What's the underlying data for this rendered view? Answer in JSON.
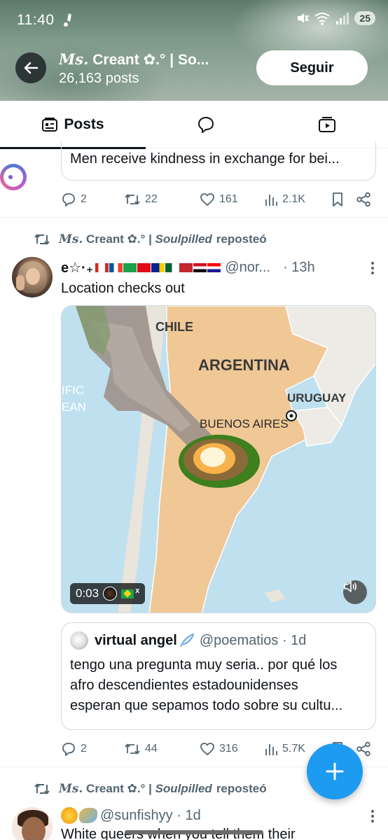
{
  "status_bar": {
    "time": "11:40",
    "battery": "25",
    "network": "5"
  },
  "header": {
    "title_prefix": "Ms.",
    "title_rest": " Creant ✿.° | So...",
    "post_count": "26,163 posts",
    "follow_label": "Seguir"
  },
  "tabs": {
    "posts_label": "Posts"
  },
  "post1": {
    "quote_text": "Men receive kindness in exchange for bei...",
    "replies": "2",
    "reposts": "22",
    "likes": "161",
    "views": "2.1K"
  },
  "post2": {
    "repost_by_serif": "Ms.",
    "repost_by_rest": " Creant ✿.° | ",
    "repost_by_ital": "Soulpilled",
    "repost_verb": "reposteó",
    "author_name": "e☆·₊",
    "author_handle": "@nor...",
    "time": "· 13h",
    "text": "Location checks out",
    "map_labels": {
      "chile": "CHILE",
      "argentina": "ARGENTINA",
      "uruguay": "URUGUAY",
      "buenos_aires": "BUENOS AIRES",
      "pacific1": "IFIC",
      "pacific2": "EAN"
    },
    "video_time": "0:03",
    "video_badge_x": "x",
    "quote": {
      "name": "virtual angel",
      "handle": "@poematios · 1d",
      "lines": [
        "tengo una pregunta muy seria.. por qué los",
        "afro descendientes estadounidenses",
        "esperan que sepamos todo sobre su cultu..."
      ]
    },
    "replies": "2",
    "reposts": "44",
    "likes": "316",
    "views": "5.7K"
  },
  "post3": {
    "repost_by_serif": "Ms.",
    "repost_by_rest": " Creant ✿.° | ",
    "repost_by_ital": "Soulpilled",
    "repost_verb": "reposteó",
    "handle": "@sunfishyy · 1d",
    "text": "White queers when you tell them their"
  },
  "colors": {
    "accent": "#1d9bf0",
    "muted": "#536471",
    "text": "#0f1419",
    "map_land": "#f0c896",
    "map_sea": "#bfe0ef"
  },
  "icons": [
    "back-arrow-icon",
    "posts-tab-icon",
    "replies-tab-icon",
    "media-tab-icon",
    "reply-icon",
    "repost-icon",
    "like-icon",
    "views-icon",
    "bookmark-icon",
    "share-icon",
    "more-icon",
    "mute-icon",
    "compose-plus-icon"
  ]
}
